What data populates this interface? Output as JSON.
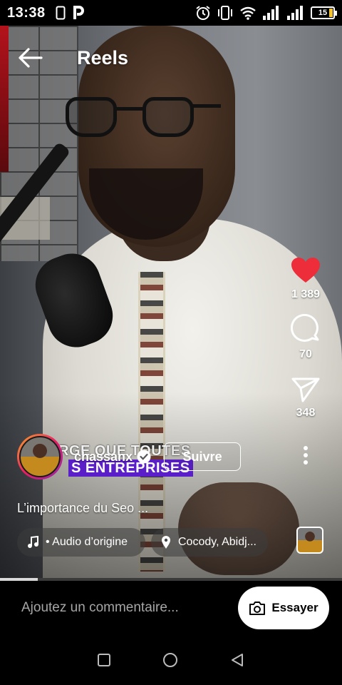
{
  "status_bar": {
    "time": "13:38",
    "battery": "15",
    "icons": [
      "phone-icon",
      "p-app-icon",
      "alarm-icon",
      "vibrate-icon",
      "wifi-icon",
      "signal-icon",
      "signal-icon",
      "battery-icon"
    ]
  },
  "header": {
    "title": "Reels",
    "back_icon": "arrow-left-icon"
  },
  "video_overlay_text": {
    "line1": "RGE QUE TOUTES",
    "line2": "S ENTREPRISES"
  },
  "actions": {
    "like_count": "1 389",
    "comment_count": "70",
    "share_count": "348",
    "like_color": "#ed2d3a"
  },
  "author": {
    "username": "chassanx",
    "follow_label": "Suivre"
  },
  "reel": {
    "description": "L’importance du Seo ...",
    "audio_label": "• Audio d’origine",
    "location_label": "Cocody, Abidj..."
  },
  "progress": {
    "played_fraction": 0.11
  },
  "comment": {
    "placeholder": "Ajoutez un commentaire...",
    "try_label": "Essayer"
  },
  "nav": {
    "icons": [
      "recent-apps-icon",
      "home-icon",
      "back-triangle-icon"
    ]
  }
}
